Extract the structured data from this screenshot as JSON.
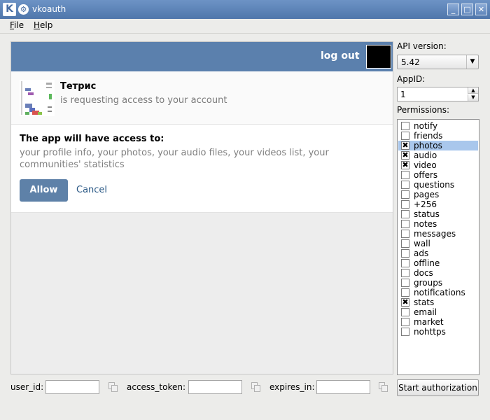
{
  "window": {
    "title": "vkoauth"
  },
  "titlebar_buttons": [
    "_",
    "□",
    "✕"
  ],
  "menu": [
    "File",
    "Help"
  ],
  "webview": {
    "logout_label": "log out",
    "app_name": "Тетрис",
    "app_subtitle": "is requesting access to your account",
    "access_title": "The app will have access to:",
    "access_list": "your profile info, your photos, your audio files, your videos list, your communities' statistics",
    "allow_label": "Allow",
    "cancel_label": "Cancel"
  },
  "panel": {
    "api_version_label": "API version:",
    "api_version_value": "5.42",
    "appid_label": "AppID:",
    "appid_value": "1",
    "permissions_label": "Permissions:",
    "permissions": [
      {
        "name": "notify",
        "checked": false,
        "selected": false
      },
      {
        "name": "friends",
        "checked": false,
        "selected": false
      },
      {
        "name": "photos",
        "checked": true,
        "selected": true
      },
      {
        "name": "audio",
        "checked": true,
        "selected": false
      },
      {
        "name": "video",
        "checked": true,
        "selected": false
      },
      {
        "name": "offers",
        "checked": false,
        "selected": false
      },
      {
        "name": "questions",
        "checked": false,
        "selected": false
      },
      {
        "name": "pages",
        "checked": false,
        "selected": false
      },
      {
        "name": "+256",
        "checked": false,
        "selected": false
      },
      {
        "name": "status",
        "checked": false,
        "selected": false
      },
      {
        "name": "notes",
        "checked": false,
        "selected": false
      },
      {
        "name": "messages",
        "checked": false,
        "selected": false
      },
      {
        "name": "wall",
        "checked": false,
        "selected": false
      },
      {
        "name": "ads",
        "checked": false,
        "selected": false
      },
      {
        "name": "offline",
        "checked": false,
        "selected": false
      },
      {
        "name": "docs",
        "checked": false,
        "selected": false
      },
      {
        "name": "groups",
        "checked": false,
        "selected": false
      },
      {
        "name": "notifications",
        "checked": false,
        "selected": false
      },
      {
        "name": "stats",
        "checked": true,
        "selected": false
      },
      {
        "name": "email",
        "checked": false,
        "selected": false
      },
      {
        "name": "market",
        "checked": false,
        "selected": false
      },
      {
        "name": "nohttps",
        "checked": false,
        "selected": false
      }
    ]
  },
  "bottom": {
    "user_id_label": "user_id:",
    "user_id_value": "",
    "access_token_label": "access_token:",
    "access_token_value": "",
    "expires_in_label": "expires_in:",
    "expires_in_value": "",
    "start_label": "Start authorization"
  },
  "colors": {
    "titlebar": "#4f76ab",
    "vk_header": "#5b80ad",
    "allow_button": "#5e81a8",
    "selection": "#a9c7ec"
  }
}
